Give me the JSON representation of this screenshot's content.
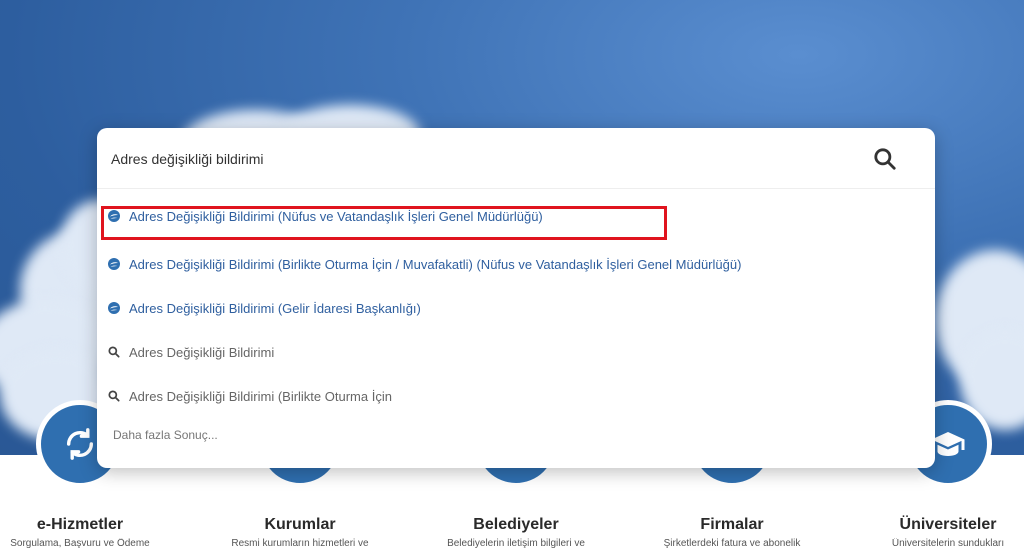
{
  "search": {
    "value": "Adres değişikliği bildirimi",
    "suggestions": [
      {
        "type": "service",
        "icon": "edevlet-logo-icon",
        "text": "Adres Değişikliği Bildirimi (Nüfus ve Vatandaşlık İşleri Genel Müdürlüğü)"
      },
      {
        "type": "service",
        "icon": "edevlet-logo-icon",
        "text": "Adres Değişikliği Bildirimi (Birlikte Oturma İçin / Muvafakatli) (Nüfus ve Vatandaşlık İşleri Genel Müdürlüğü)"
      },
      {
        "type": "service",
        "icon": "edevlet-logo-icon",
        "text": "Adres Değişikliği Bildirimi (Gelir İdaresi Başkanlığı)"
      },
      {
        "type": "query",
        "icon": "search-icon",
        "text": "Adres Değişikliği Bildirimi"
      },
      {
        "type": "query",
        "icon": "search-icon",
        "text": "Adres Değişikliği Bildirimi (Birlikte Oturma İçin"
      }
    ],
    "more_label": "Daha fazla Sonuç..."
  },
  "categories": [
    {
      "title": "e-Hizmetler",
      "desc": "Sorgulama, Başvuru ve Ödeme",
      "icon": "refresh-icon"
    },
    {
      "title": "Kurumlar",
      "desc": "Resmi kurumların hizmetleri ve",
      "icon": "building-icon"
    },
    {
      "title": "Belediyeler",
      "desc": "Belediyelerin iletişim bilgileri ve",
      "icon": "city-icon"
    },
    {
      "title": "Firmalar",
      "desc": "Şirketlerdeki fatura ve abonelik",
      "icon": "briefcase-icon"
    },
    {
      "title": "Üniversiteler",
      "desc": "Üniversitelerin sundukları",
      "icon": "graduation-cap-icon"
    }
  ],
  "colors": {
    "accent": "#2f6fb0",
    "highlight": "#e0141e",
    "link": "#2f5f9f"
  }
}
